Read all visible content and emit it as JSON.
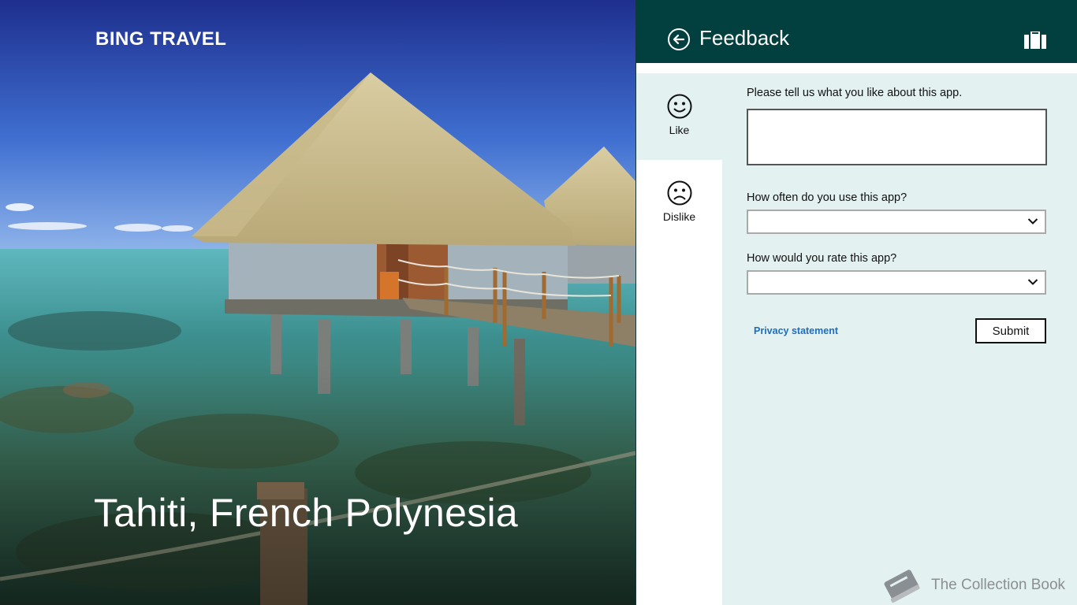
{
  "app": {
    "title": "BING TRAVEL"
  },
  "hero": {
    "place": "Tahiti, French Polynesia"
  },
  "flyout": {
    "title": "Feedback",
    "tabs": [
      {
        "label": "Like",
        "icon": "smile-icon",
        "selected": true
      },
      {
        "label": "Dislike",
        "icon": "frown-icon",
        "selected": false
      }
    ],
    "form": {
      "like_prompt": "Please tell us what you like about this app.",
      "like_value": "",
      "frequency_label": "How often do you use this app?",
      "frequency_value": "",
      "rating_label": "How would you rate this app?",
      "rating_value": "",
      "privacy_link": "Privacy statement",
      "submit_label": "Submit"
    }
  },
  "watermark": {
    "text": "The Collection Book"
  },
  "colors": {
    "header_bg": "#024040",
    "flyout_bg": "#e4f1f1",
    "link": "#1d6dbd"
  }
}
